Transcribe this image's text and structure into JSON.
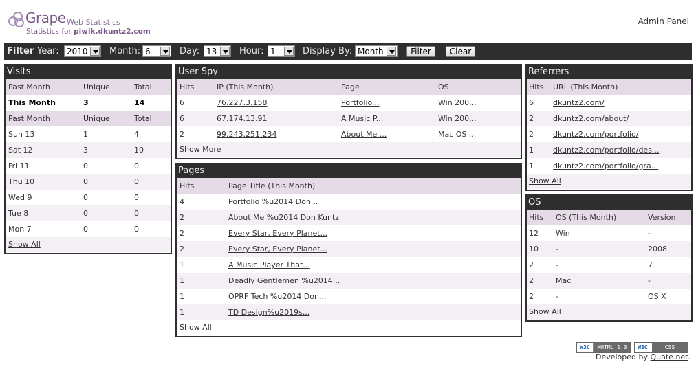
{
  "header": {
    "brand": "Grape",
    "brand_sub": "Web Statistics",
    "stats_for_prefix": "Statistics for",
    "site": "piwik.dkuntz2.com",
    "admin_link": "Admin Panel"
  },
  "filter": {
    "title": "Filter",
    "year_label": "Year:",
    "year_value": "2010",
    "month_label": "Month:",
    "month_value": "6",
    "day_label": "Day:",
    "day_value": "13",
    "hour_label": "Hour:",
    "hour_value": "1",
    "display_label": "Display By:",
    "display_value": "Month",
    "filter_button": "Filter",
    "clear_button": "Clear"
  },
  "visits": {
    "title": "Visits",
    "month_header": [
      "Past Month",
      "Unique",
      "Total"
    ],
    "this_month": [
      "This Month",
      "3",
      "14"
    ],
    "days_header": [
      "Past Month",
      "Unique",
      "Total"
    ],
    "days": [
      [
        "Sun 13",
        "1",
        "4"
      ],
      [
        "Sat 12",
        "3",
        "10"
      ],
      [
        "Fri 11",
        "0",
        "0"
      ],
      [
        "Thu 10",
        "0",
        "0"
      ],
      [
        "Wed 9",
        "0",
        "0"
      ],
      [
        "Tue 8",
        "0",
        "0"
      ],
      [
        "Mon 7",
        "0",
        "0"
      ]
    ],
    "show_all": "Show All"
  },
  "userspy": {
    "title": "User Spy",
    "headers": [
      "Hits",
      "IP (This Month)",
      "Page",
      "OS"
    ],
    "rows": [
      [
        "6",
        "76.227.3.158",
        "Portfolio...",
        "Win 200..."
      ],
      [
        "6",
        "67.174.13.91",
        "A Music P...",
        "Win 200..."
      ],
      [
        "2",
        "99.243.251.234",
        "About Me ...",
        "Mac OS ..."
      ]
    ],
    "show_more": "Show More"
  },
  "pages": {
    "title": "Pages",
    "headers": [
      "Hits",
      "Page Title (This Month)"
    ],
    "rows": [
      [
        "4",
        "Portfolio %u2014 Don..."
      ],
      [
        "2",
        "About Me %u2014 Don Kuntz"
      ],
      [
        "2",
        "Every Star, Every Planet..."
      ],
      [
        "2",
        "Every Star, Every Planet..."
      ],
      [
        "1",
        "A Music Player That..."
      ],
      [
        "1",
        "Deadly Gentlemen %u2014..."
      ],
      [
        "1",
        "OPRF Tech %u2014 Don..."
      ],
      [
        "1",
        "TD Design%u2019s..."
      ]
    ],
    "show_all": "Show All"
  },
  "referrers": {
    "title": "Referrers",
    "headers": [
      "Hits",
      "URL (This Month)"
    ],
    "rows": [
      [
        "6",
        "dkuntz2.com/"
      ],
      [
        "2",
        "dkuntz2.com/about/"
      ],
      [
        "2",
        "dkuntz2.com/portfolio/"
      ],
      [
        "1",
        "dkuntz2.com/portfolio/des..."
      ],
      [
        "1",
        "dkuntz2.com/portfolio/gra..."
      ]
    ],
    "show_all": "Show All"
  },
  "os": {
    "title": "OS",
    "headers": [
      "Hits",
      "OS (This Month)",
      "Version"
    ],
    "rows": [
      [
        "12",
        "Win",
        "-"
      ],
      [
        "10",
        "-",
        "2008"
      ],
      [
        "2",
        "-",
        "7"
      ],
      [
        "2",
        "Mac",
        "-"
      ],
      [
        "2",
        "-",
        "OS X"
      ]
    ],
    "show_all": "Show All"
  },
  "footer": {
    "badge1_w3c": "W3C",
    "badge1_text": "XHTML 1.0",
    "badge2_w3c": "W3C",
    "badge2_text": "CSS",
    "developed_prefix": "Developed by",
    "developer": "Quate.net",
    "developed_suffix": "."
  },
  "colors": {
    "dark": "#2e2e2e",
    "header_row": "#e5dbe7",
    "alt_row": "#f4eef5",
    "brand": "#7c5b8a"
  }
}
